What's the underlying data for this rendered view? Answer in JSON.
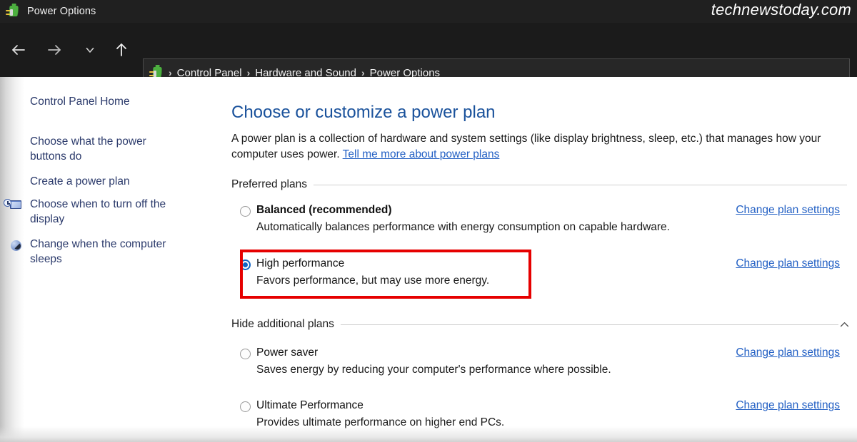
{
  "window": {
    "title": "Power Options",
    "icon": "power-plug-icon",
    "watermark": "technewstoday.com"
  },
  "toolbar": {
    "back": "back-arrow-icon",
    "forward": "forward-arrow-icon",
    "recent": "chevron-down-icon",
    "up": "up-arrow-icon"
  },
  "breadcrumb": {
    "icon": "power-plug-icon",
    "separator": "›",
    "items": [
      "Control Panel",
      "Hardware and Sound",
      "Power Options"
    ]
  },
  "sidebar": {
    "items": [
      {
        "label": "Control Panel Home",
        "icon": null
      },
      {
        "label": "Choose what the power buttons do",
        "icon": null
      },
      {
        "label": "Create a power plan",
        "icon": null
      },
      {
        "label": "Choose when to turn off the display",
        "icon": "display-clock-icon"
      },
      {
        "label": "Change when the computer sleeps",
        "icon": "sleep-moon-icon"
      }
    ]
  },
  "main": {
    "title": "Choose or customize a power plan",
    "description_part1": "A power plan is a collection of hardware and system settings (like display brightness, sleep, etc.) that manages how your computer uses power. ",
    "description_link": "Tell me more about power plans",
    "sections": {
      "preferred": "Preferred plans",
      "additional": "Hide additional plans",
      "collapse_icon": "chevron-up-icon"
    },
    "change_link_label": "Change plan settings",
    "plans": [
      {
        "name": "Balanced (recommended)",
        "description": "Automatically balances performance with energy consumption on capable hardware.",
        "selected": false,
        "bold": true,
        "highlighted": false
      },
      {
        "name": "High performance",
        "description": "Favors performance, but may use more energy.",
        "selected": true,
        "bold": false,
        "highlighted": true
      },
      {
        "name": "Power saver",
        "description": "Saves energy by reducing your computer's performance where possible.",
        "selected": false,
        "bold": false,
        "highlighted": false
      },
      {
        "name": "Ultimate Performance",
        "description": "Provides ultimate performance on higher end PCs.",
        "selected": false,
        "bold": false,
        "highlighted": false
      }
    ]
  },
  "colors": {
    "titlebar_bg": "#202020",
    "navbar_bg": "#1b1b1b",
    "link_blue": "#2360c4",
    "heading_blue": "#19519b",
    "sidebar_link": "#2b3a6b",
    "radio_selected": "#1164c4",
    "annotation_red": "#e60000"
  }
}
